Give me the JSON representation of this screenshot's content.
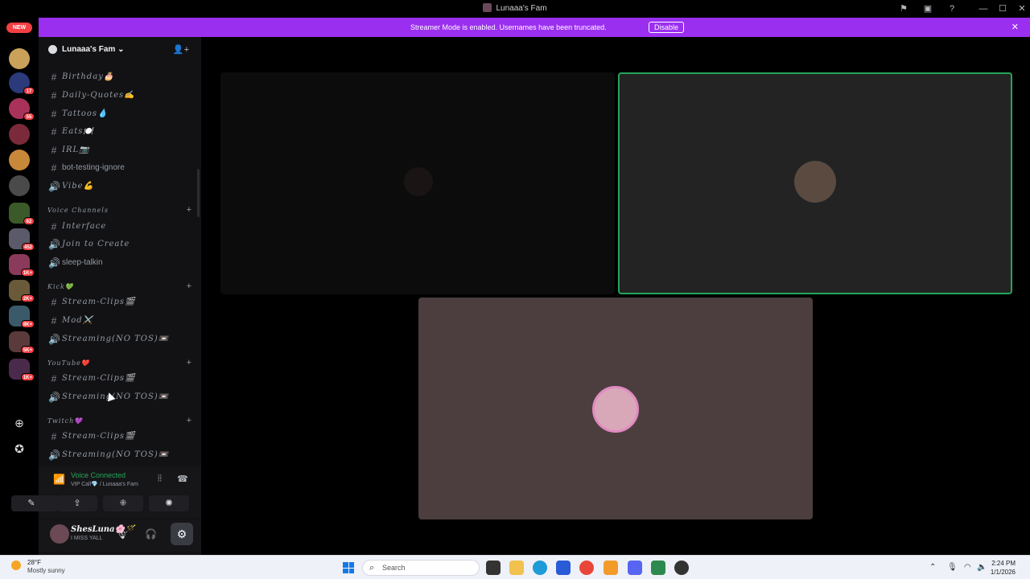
{
  "window": {
    "title": "Lunaaa's Fam"
  },
  "banner": {
    "text": "Streamer Mode is enabled. Usernames have been truncated.",
    "button": "Disable"
  },
  "rail": {
    "new_badge": "NEW",
    "badges": [
      "17",
      "55",
      "62",
      "452",
      "1K+",
      "2K+",
      "8K+",
      "5K+",
      "1K+"
    ]
  },
  "server": {
    "name": "Lunaaa's Fam"
  },
  "channels": {
    "top": [
      {
        "name": "Birthday🎂",
        "type": "text"
      },
      {
        "name": "Daily-Quotes✍️",
        "type": "text"
      },
      {
        "name": "Tattoos💧",
        "type": "text"
      },
      {
        "name": "Eats🍽️",
        "type": "text"
      },
      {
        "name": "IRL📷",
        "type": "text"
      },
      {
        "name": "bot-testing-ignore",
        "type": "text"
      },
      {
        "name": "Vibe💪",
        "type": "voice"
      }
    ],
    "categories": [
      {
        "name": "Voice Channels",
        "items": [
          {
            "name": "Interface",
            "type": "text"
          },
          {
            "name": "Join to Create",
            "type": "voice"
          },
          {
            "name": "sleep-talkin",
            "type": "voice"
          }
        ]
      },
      {
        "name": "Kick💚",
        "items": [
          {
            "name": "Stream-Clips🎬",
            "type": "text"
          },
          {
            "name": "Mod⚔️",
            "type": "text"
          },
          {
            "name": "Streaming(NO TOS)📼",
            "type": "voice"
          }
        ]
      },
      {
        "name": "YouTube❤️",
        "items": [
          {
            "name": "Stream-Clips🎬",
            "type": "text"
          },
          {
            "name": "Streaming(NO TOS)📼",
            "type": "voice"
          }
        ]
      },
      {
        "name": "Twitch💜",
        "items": [
          {
            "name": "Stream-Clips🎬",
            "type": "text"
          },
          {
            "name": "Streaming(NO TOS)📼",
            "type": "voice"
          }
        ]
      }
    ]
  },
  "voice": {
    "status": "Voice Connected",
    "channel": "VIP Call💎 / Lunaaa's Fam"
  },
  "user": {
    "name": "ShesLuna🌸🪄",
    "status": "I MISS YALL"
  },
  "taskbar": {
    "temp": "28°F",
    "weather": "Mostly sunny",
    "search_placeholder": "Search",
    "time": "2:24 PM",
    "date": "1/1/2026"
  },
  "colors": {
    "banner": "#9b2ff0",
    "speaking_ring": "#23a55a",
    "tile_dark": "#0c0c0c",
    "tile_mid": "#232323",
    "tile_brown": "#4c3e3e"
  }
}
